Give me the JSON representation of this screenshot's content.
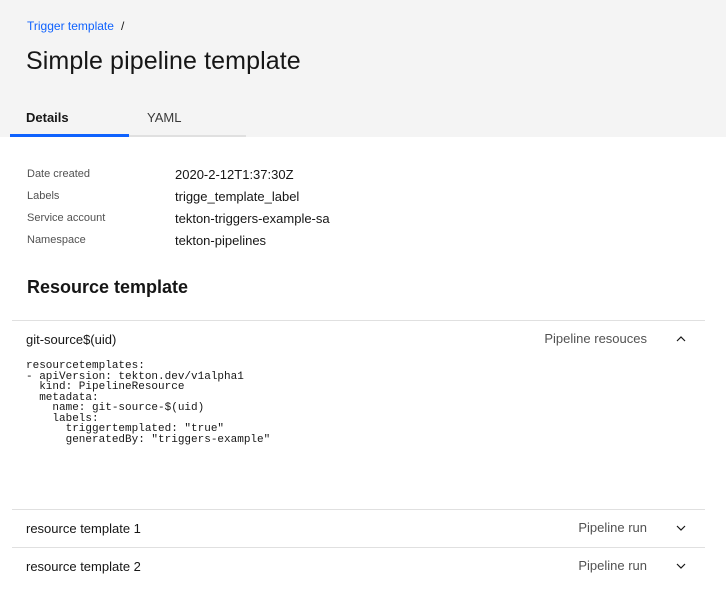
{
  "breadcrumb": {
    "link": "Trigger template",
    "separator": "/"
  },
  "page_title": "Simple pipeline template",
  "tabs": [
    {
      "label": "Details",
      "active": true
    },
    {
      "label": "YAML",
      "active": false
    }
  ],
  "details": [
    {
      "label": "Date created",
      "value": "2020-2-12T1:37:30Z"
    },
    {
      "label": "Labels",
      "value": "trigge_template_label"
    },
    {
      "label": "Service account",
      "value": "tekton-triggers-example-sa"
    },
    {
      "label": "Namespace",
      "value": "tekton-pipelines"
    }
  ],
  "resource_section_title": "Resource template",
  "resources": [
    {
      "name": "git-source$(uid)",
      "type": "Pipeline resouces",
      "expanded": true,
      "chevron_icon": "chevron-up-icon",
      "yaml": "resourcetemplates:\n- apiVersion: tekton.dev/v1alpha1\n  kind: PipelineResource\n  metadata:\n    name: git-source-$(uid)\n    labels:\n      triggertemplated: \"true\"\n      generatedBy: \"triggers-example\""
    },
    {
      "name": "resource template 1",
      "type": "Pipeline run",
      "expanded": false,
      "chevron_icon": "chevron-down-icon"
    },
    {
      "name": "resource template 2",
      "type": "Pipeline run",
      "expanded": false,
      "chevron_icon": "chevron-down-icon"
    }
  ],
  "colors": {
    "link": "#0f62fe",
    "header_bg": "#f4f4f4",
    "divider": "#e0e0e0"
  }
}
